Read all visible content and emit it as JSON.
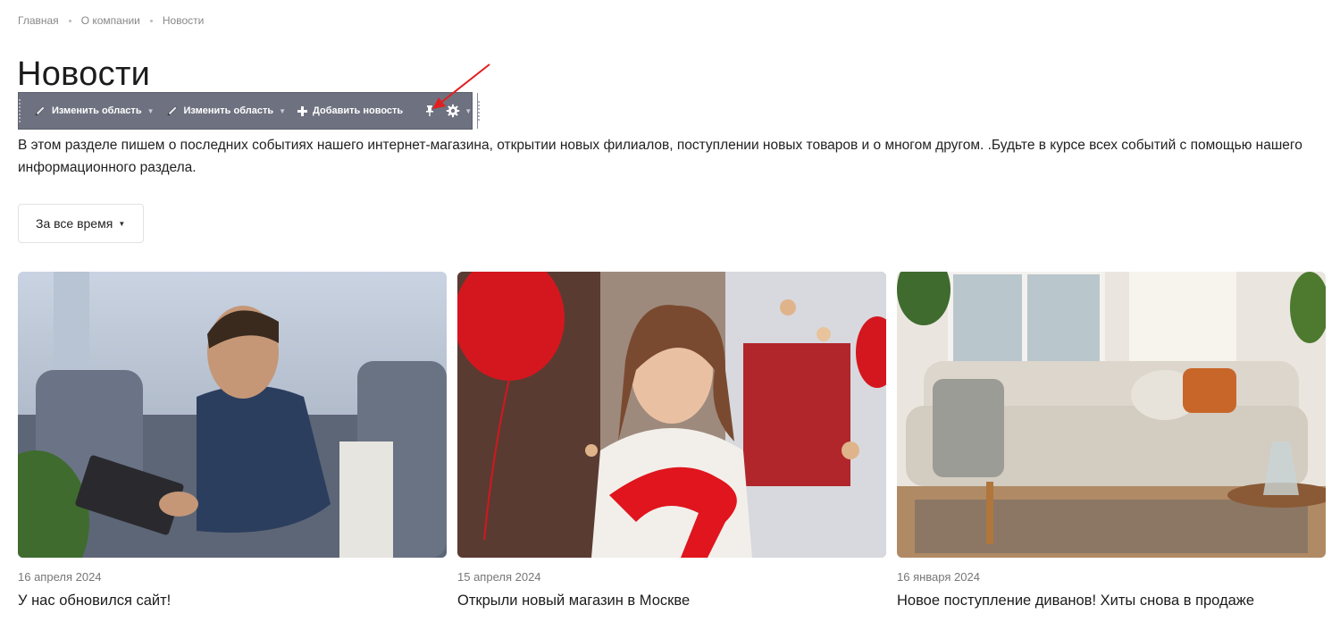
{
  "breadcrumb": [
    {
      "label": "Главная"
    },
    {
      "label": "О компании"
    },
    {
      "label": "Новости"
    }
  ],
  "page_title": "Новости",
  "admin_toolbar": {
    "edit_area_1": "Изменить область",
    "edit_area_2": "Изменить область",
    "add_news": "Добавить новость",
    "icons": [
      "pencil-icon",
      "pencil-icon",
      "plus-icon",
      "pin-icon",
      "gear-icon"
    ]
  },
  "intro_text": "В этом разделе пишем о последних событиях нашего интернет-магазина, открытии новых филиалов, поступлении новых товаров и о многом другом. .Будьте в курсе всех событий с помощью нашего информационного раздела.",
  "period_filter": {
    "label": "За все время"
  },
  "news": [
    {
      "date": "16 апреля 2024",
      "title": "У нас обновился сайт!"
    },
    {
      "date": "15 апреля 2024",
      "title": "Открыли новый магазин в Москве"
    },
    {
      "date": "16 января 2024",
      "title": "Новое поступление диванов! Хиты снова в продаже"
    }
  ],
  "colors": {
    "toolbar_bg": "#6e7280",
    "annotation_arrow": "#e02020",
    "text_primary": "#1c1c1c",
    "text_muted": "#888888"
  }
}
